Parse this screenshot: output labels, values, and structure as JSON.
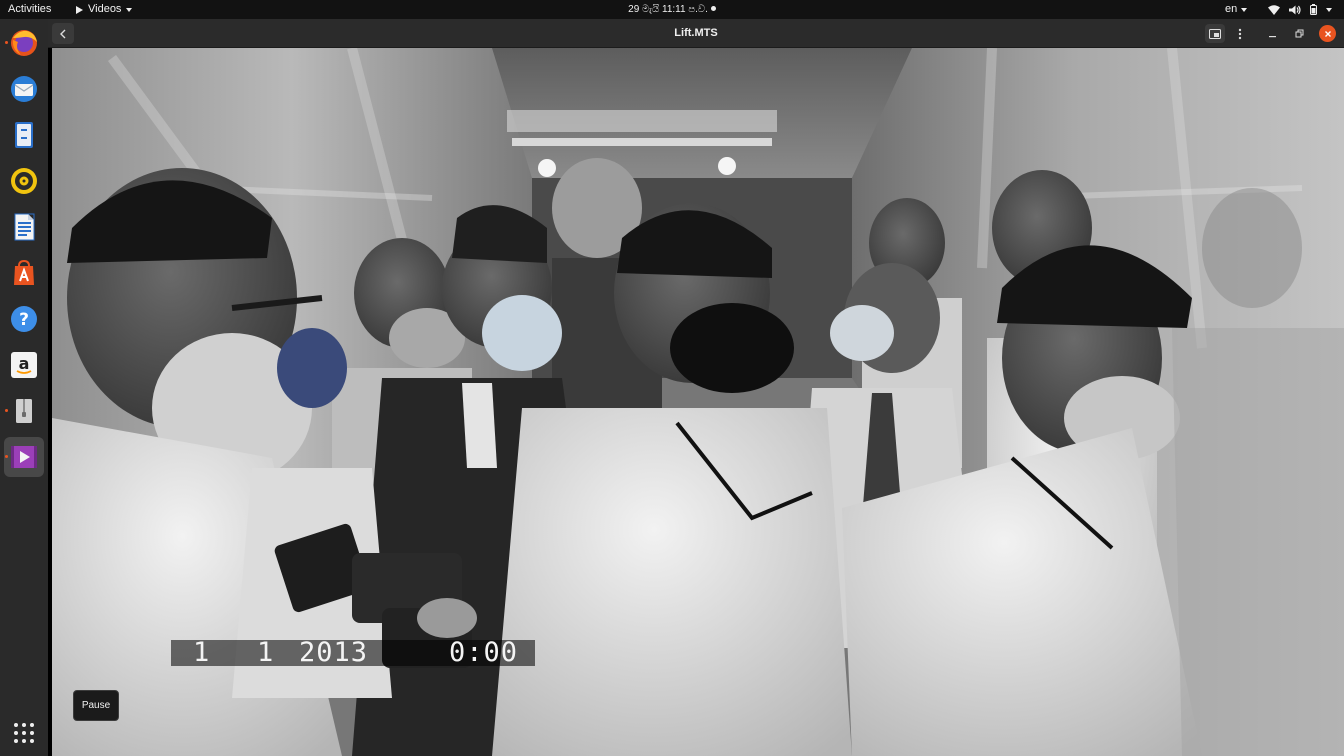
{
  "topbar": {
    "activities": "Activities",
    "app_menu": "Videos",
    "clock": "29 මැයි  11:11 ප.ව.",
    "language": "en"
  },
  "dock": {
    "items": [
      {
        "name": "firefox-icon",
        "running": true
      },
      {
        "name": "thunderbird-icon",
        "running": false
      },
      {
        "name": "files-icon",
        "running": false
      },
      {
        "name": "rhythmbox-icon",
        "running": false
      },
      {
        "name": "writer-icon",
        "running": false
      },
      {
        "name": "software-icon",
        "running": false
      },
      {
        "name": "help-icon",
        "running": false
      },
      {
        "name": "amazon-icon",
        "running": false
      },
      {
        "name": "archive-icon",
        "running": true
      },
      {
        "name": "videos-icon",
        "running": true
      }
    ]
  },
  "window": {
    "title": "Lift.MTS"
  },
  "video": {
    "date_day": "1",
    "date_month": "1",
    "date_year": "2013",
    "time": "0:00"
  },
  "tooltip": {
    "pause": "Pause"
  },
  "colors": {
    "accent": "#e95420",
    "topbar": "#121212",
    "dock": "#2a2a2a",
    "titlebar": "#2b2b2b"
  }
}
